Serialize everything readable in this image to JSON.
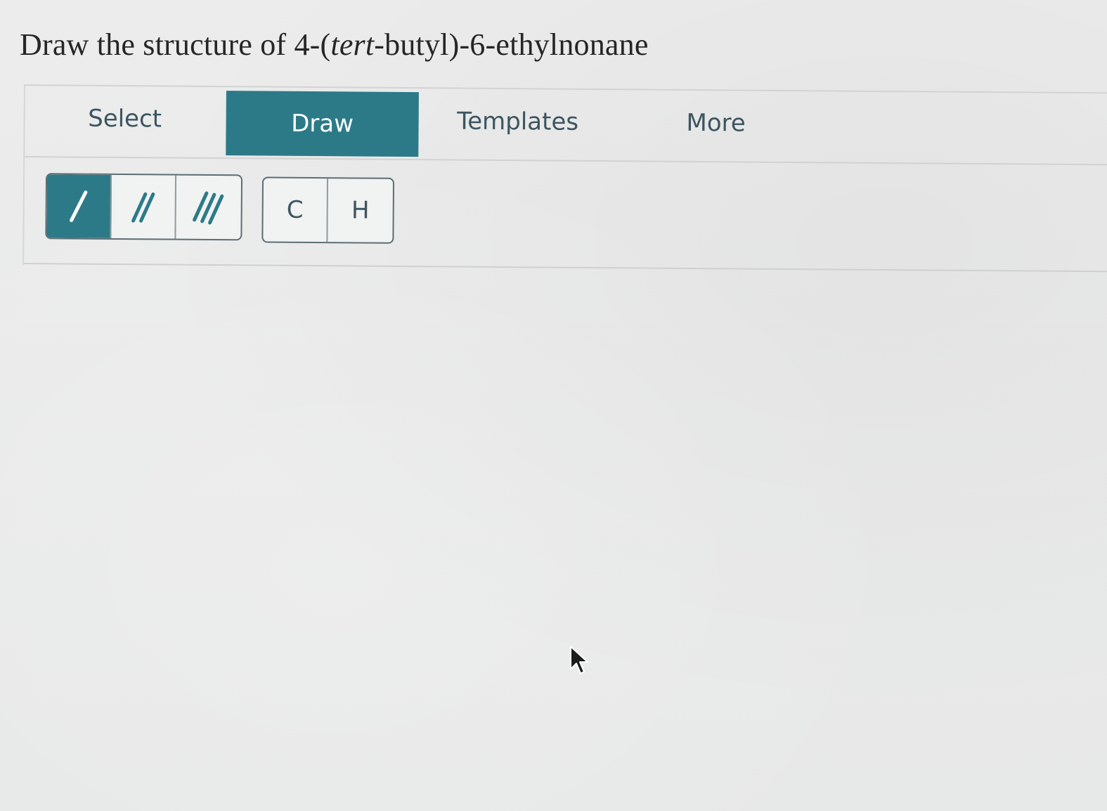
{
  "question": {
    "prefix": "Draw the structure of 4-(",
    "italic": "tert",
    "suffix": "-butyl)-6-ethylnonane"
  },
  "tabs": [
    {
      "label": "Select",
      "active": false
    },
    {
      "label": "Draw",
      "active": true
    },
    {
      "label": "Templates",
      "active": false
    },
    {
      "label": "More",
      "active": false
    }
  ],
  "bond_tools": [
    {
      "icon": "single-bond-icon",
      "active": true
    },
    {
      "icon": "double-bond-icon",
      "active": false
    },
    {
      "icon": "triple-bond-icon",
      "active": false
    }
  ],
  "atom_tools": [
    {
      "label": "C"
    },
    {
      "label": "H"
    }
  ],
  "colors": {
    "accent": "#2c7a88",
    "text": "#3c5560",
    "background": "#e9eaea"
  }
}
